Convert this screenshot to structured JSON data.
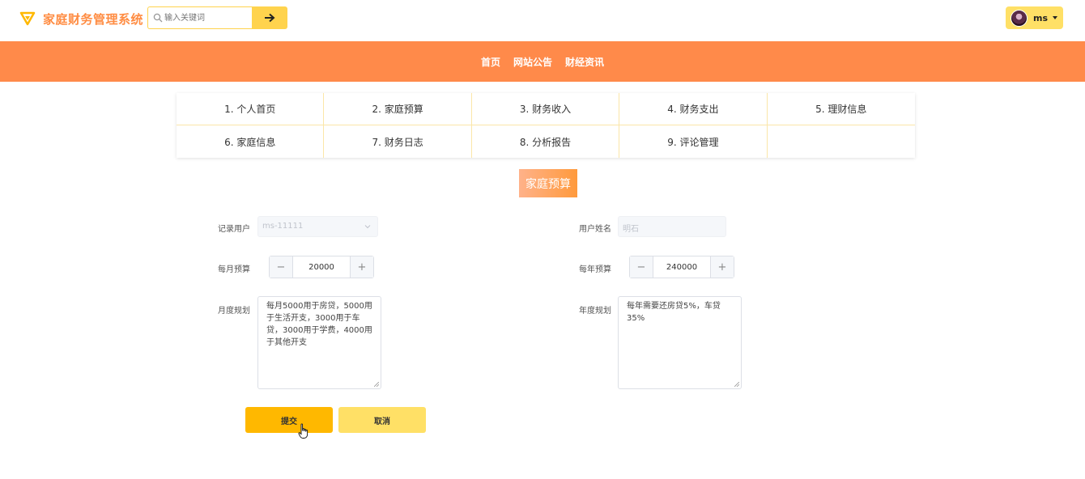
{
  "header": {
    "brand": "家庭财务管理系统",
    "search_placeholder": "输入关键词",
    "user_name": "ms"
  },
  "nav": {
    "items": [
      "首页",
      "网站公告",
      "财经资讯"
    ]
  },
  "menu": {
    "items": [
      "1. 个人首页",
      "2. 家庭预算",
      "3. 财务收入",
      "4. 财务支出",
      "5. 理财信息",
      "6. 家庭信息",
      "7. 财务日志",
      "8. 分析报告",
      "9. 评论管理",
      ""
    ]
  },
  "section": {
    "title": "家庭预算"
  },
  "form": {
    "record_user_label": "记录用户",
    "record_user_value": "ms-11111",
    "user_name_label": "用户姓名",
    "user_name_value": "明石",
    "monthly_budget_label": "每月预算",
    "monthly_budget_value": "20000",
    "yearly_budget_label": "每年预算",
    "yearly_budget_value": "240000",
    "monthly_plan_label": "月度规划",
    "monthly_plan_value": "每月5000用于房贷，5000用于生活开支，3000用于车贷，3000用于学费，4000用于其他开支",
    "yearly_plan_label": "年度规划",
    "yearly_plan_value": "每年需要还房贷5%，车贷35%",
    "submit_label": "提交",
    "cancel_label": "取消"
  },
  "colors": {
    "brand": "#ff8c42",
    "nav_bg": "#ff8a4a",
    "primary_button": "#ffb800",
    "secondary_button": "#ffe066"
  }
}
